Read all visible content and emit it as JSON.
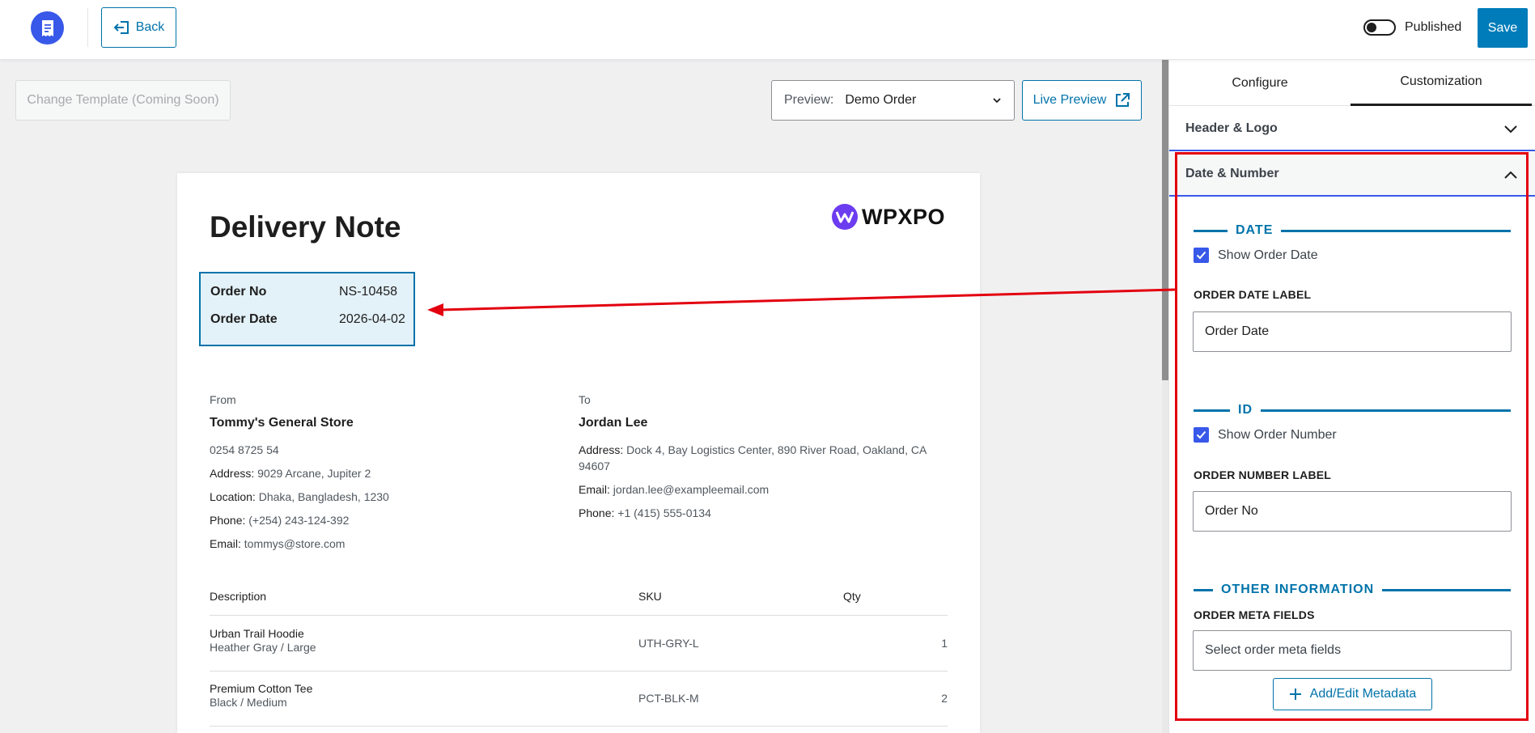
{
  "topbar": {
    "back_label": "Back",
    "publish_label": "Published",
    "published": false,
    "save_label": "Save"
  },
  "toolbar": {
    "change_template_label": "Change Template (Coming Soon)",
    "preview_label": "Preview:",
    "preview_value": "Demo Order",
    "live_preview_label": "Live Preview"
  },
  "document": {
    "title": "Delivery Note",
    "logo_text": "WPXPO",
    "order_no_label": "Order No",
    "order_no_value": "NS-10458",
    "order_date_label": "Order Date",
    "order_date_value": "2026-04-02",
    "from": {
      "label": "From",
      "name": "Tommy's General Store",
      "phone_raw": "0254 8725 54",
      "address_key": "Address:",
      "address": "9029 Arcane, Jupiter 2",
      "location_key": "Location:",
      "location": "Dhaka, Bangladesh, 1230",
      "phone_key": "Phone:",
      "phone": "(+254) 243-124-392",
      "email_key": "Email:",
      "email": "tommys@store.com"
    },
    "to": {
      "label": "To",
      "name": "Jordan Lee",
      "address_key": "Address:",
      "address": "Dock 4, Bay Logistics Center, 890 River Road, Oakland, CA 94607",
      "email_key": "Email:",
      "email": "jordan.lee@exampleemail.com",
      "phone_key": "Phone:",
      "phone": "+1 (415) 555-0134"
    },
    "columns": [
      "Description",
      "SKU",
      "Qty"
    ],
    "items": [
      {
        "name": "Urban Trail Hoodie",
        "variant": "Heather Gray / Large",
        "sku": "UTH-GRY-L",
        "qty": "1"
      },
      {
        "name": "Premium Cotton Tee",
        "variant": "Black / Medium",
        "sku": "PCT-BLK-M",
        "qty": "2"
      }
    ]
  },
  "sidebar": {
    "tabs": [
      "Configure",
      "Customization"
    ],
    "active_tab": "Customization",
    "sections": {
      "header_logo": "Header & Logo",
      "date_number": "Date & Number"
    },
    "date": {
      "title": "DATE",
      "show_label": "Show Order Date",
      "show_checked": true,
      "field_label": "ORDER DATE LABEL",
      "field_value": "Order Date"
    },
    "id": {
      "title": "ID",
      "show_label": "Show Order Number",
      "show_checked": true,
      "field_label": "ORDER NUMBER LABEL",
      "field_value": "Order No"
    },
    "other": {
      "title": "OTHER INFORMATION",
      "field_label": "ORDER META FIELDS",
      "placeholder": "Select order meta fields",
      "button_label": "Add/Edit Metadata"
    }
  },
  "colors": {
    "accent": "#0073aa",
    "primary_button": "#007cba",
    "brand_icon": "#3858e9",
    "highlight_frame": "#e3000f",
    "meta_box_bg": "#e3f1f8"
  },
  "icons": {
    "app": "receipt-icon",
    "back": "back-arrow-icon",
    "external": "external-link-icon",
    "chevron": "chevron-icon",
    "check": "check-icon",
    "plus": "plus-icon"
  }
}
